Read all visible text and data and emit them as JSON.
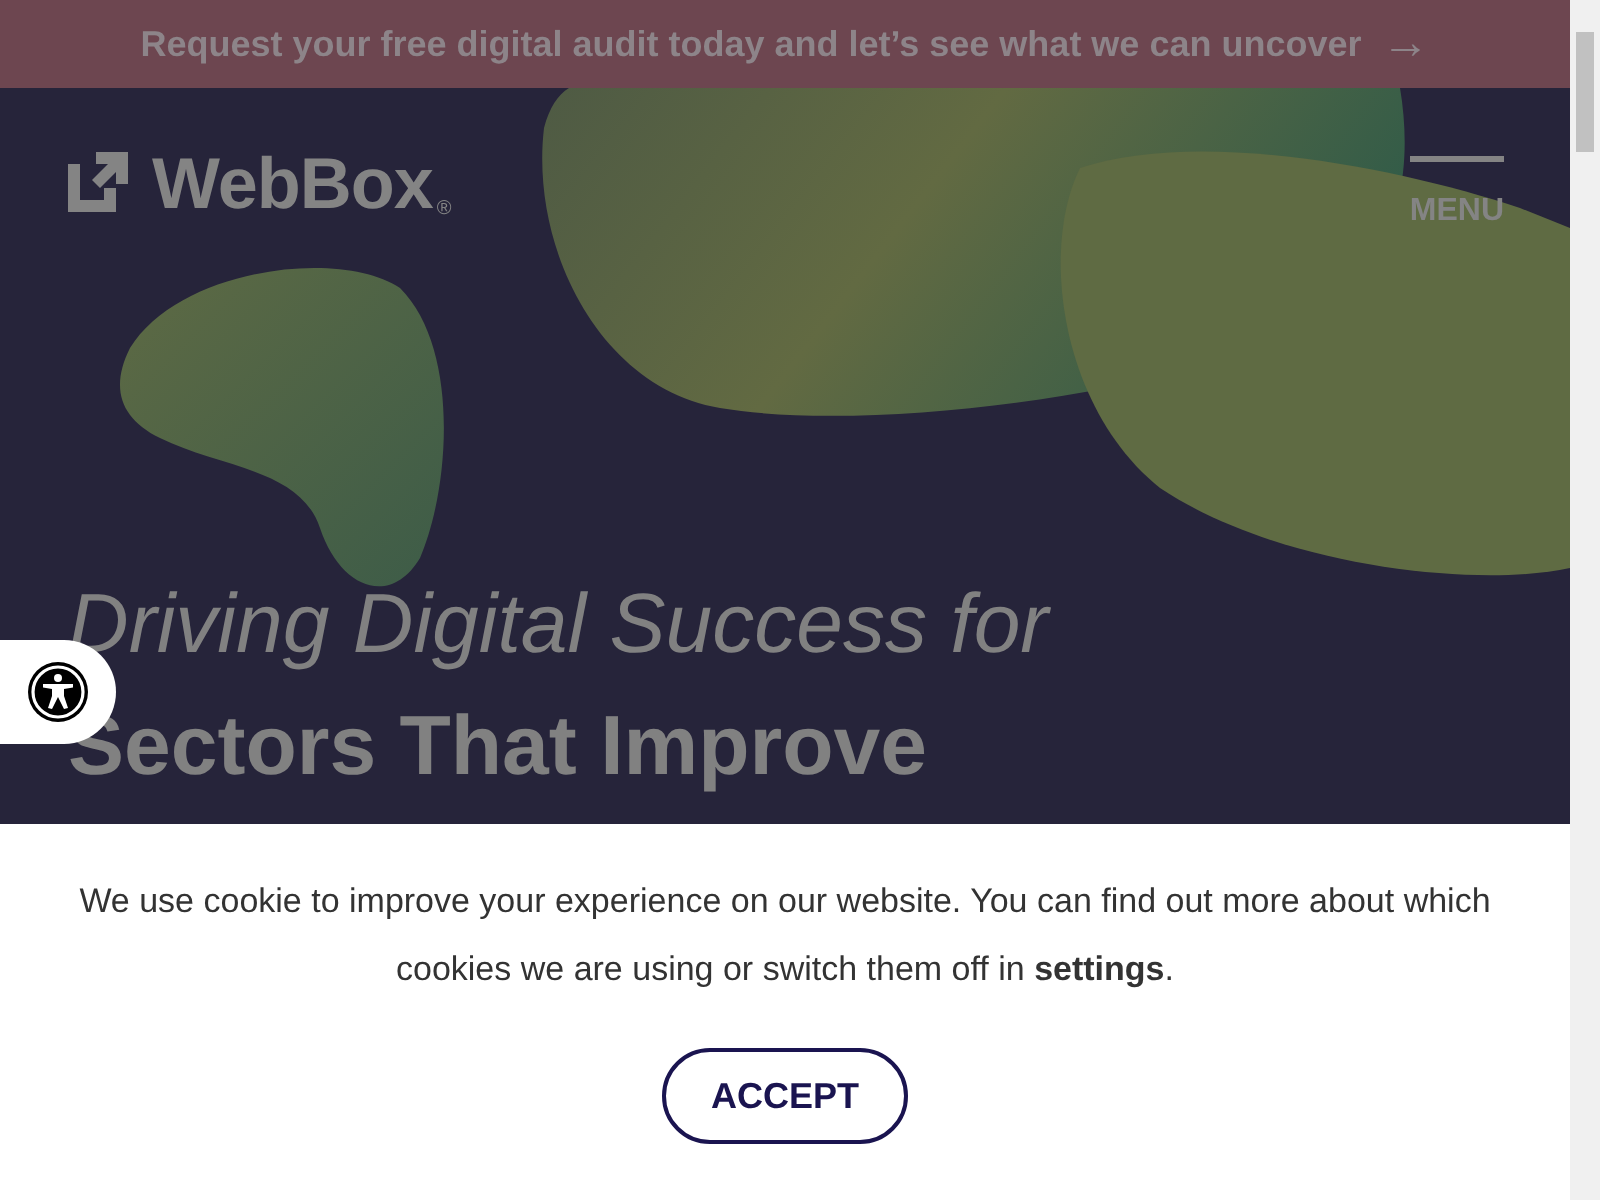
{
  "promo_bar": {
    "text": "Request your free digital audit today and let’s see what we can uncover",
    "icon": "→"
  },
  "header": {
    "logo": "WebBox",
    "registered_mark": "®",
    "menu": "MENU"
  },
  "hero": {
    "heading_lines": [
      {
        "text": "Driving Digital Success for",
        "kind": "light"
      },
      {
        "text": "Sectors That Improve",
        "kind": "bold"
      }
    ]
  },
  "cookie_notice": {
    "text": "We use cookie to improve your experience on our website. You can find out more about which cookies we are using or switch them off in **settings**.",
    "button": "ACCEPT"
  }
}
